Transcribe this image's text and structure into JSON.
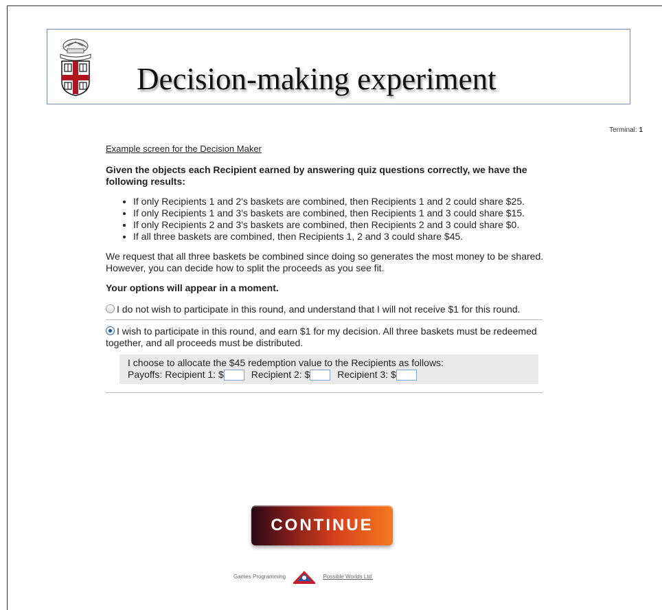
{
  "header": {
    "title": "Decision-making experiment",
    "crest_icon": "university-crest-icon"
  },
  "terminal": {
    "label": "Terminal:",
    "value": "1"
  },
  "content": {
    "example_link": "Example screen for the Decision Maker",
    "lead": "Given the objects each Recipient earned by answering quiz questions correctly, we have the following results:",
    "results": [
      "If only Recipients 1 and 2's baskets are combined, then Recipients 1 and 2 could share $25.",
      "If only Recipients 1 and 3's baskets are combined, then Recipients 1 and 3 could share $15.",
      "If only Recipients 2 and 3's baskets are combined, then Recipients 2 and 3 could share $0.",
      "If all three baskets are combined, then Recipients 1, 2 and 3 could share $45."
    ],
    "request": "We request that all three baskets be combined since doing so generates the most money to be shared. However, you can decide how to split the proceeds as you see fit.",
    "options_note": "Your options will appear in a moment.",
    "option_decline": "I do not wish to participate in this round, and understand that I will not receive $1 for this round.",
    "option_participate": "I wish to participate in this round, and earn $1 for my decision. All three baskets must be redeemed together, and all proceeds must be distributed.",
    "selected_option": "participate",
    "allocation": {
      "instruction": "I choose to allocate the $45 redemption value to the Recipients as follows:",
      "payoffs_label": "Payoffs:",
      "recipient1_label": "Recipient 1: $",
      "recipient2_label": "Recipient 2: $",
      "recipient3_label": "Recipient 3: $",
      "recipient1_value": "",
      "recipient2_value": "",
      "recipient3_value": ""
    }
  },
  "continue_label": "CONTINUE",
  "footer": {
    "text": "Games Programming",
    "link": "Possible Worlds Ltd.",
    "logo_icon": "possible-worlds-logo-icon"
  },
  "colors": {
    "header_border": "#6e8fb5",
    "button_dark": "#2a0a16",
    "button_bright": "#f37a20",
    "input_border": "#7ea6d6",
    "allocation_bg": "#eaeaea"
  }
}
